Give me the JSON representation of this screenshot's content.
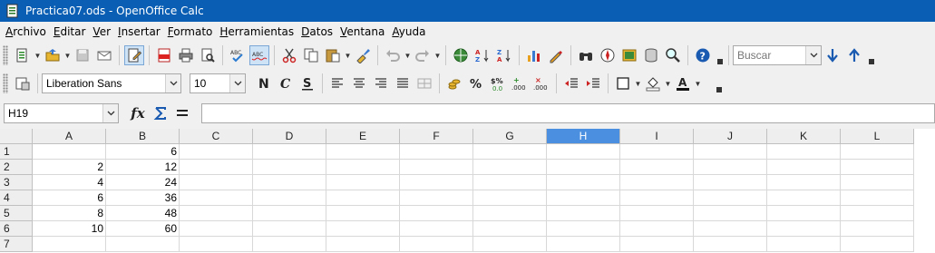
{
  "window": {
    "title": "Practica07.ods - OpenOffice Calc"
  },
  "menu": [
    {
      "acc": "A",
      "rest": "rchivo"
    },
    {
      "acc": "E",
      "rest": "ditar"
    },
    {
      "acc": "V",
      "rest": "er"
    },
    {
      "acc": "I",
      "rest": "nsertar"
    },
    {
      "acc": "F",
      "rest": "ormato"
    },
    {
      "acc": "H",
      "rest": "erramientas"
    },
    {
      "acc": "D",
      "rest": "atos"
    },
    {
      "acc": "V",
      "rest": "entana"
    },
    {
      "acc": "A",
      "rest": "yuda"
    }
  ],
  "toolbar": {
    "search_placeholder": "Buscar"
  },
  "format_toolbar": {
    "font_name": "Liberation Sans",
    "font_size": "10"
  },
  "formula_bar": {
    "name_box": "H19",
    "formula": ""
  },
  "sheet": {
    "columns": [
      "A",
      "B",
      "C",
      "D",
      "E",
      "F",
      "G",
      "H",
      "I",
      "J",
      "K",
      "L"
    ],
    "selected_column": "H",
    "rows": [
      {
        "num": "1",
        "A": "",
        "B": "6"
      },
      {
        "num": "2",
        "A": "2",
        "B": "12"
      },
      {
        "num": "3",
        "A": "4",
        "B": "24"
      },
      {
        "num": "4",
        "A": "6",
        "B": "36"
      },
      {
        "num": "5",
        "A": "8",
        "B": "48"
      },
      {
        "num": "6",
        "A": "10",
        "B": "60"
      },
      {
        "num": "7",
        "A": "",
        "B": ""
      }
    ]
  },
  "colors": {
    "titlebar": "#0a5fb4",
    "selected_header": "#4a8fe0"
  }
}
